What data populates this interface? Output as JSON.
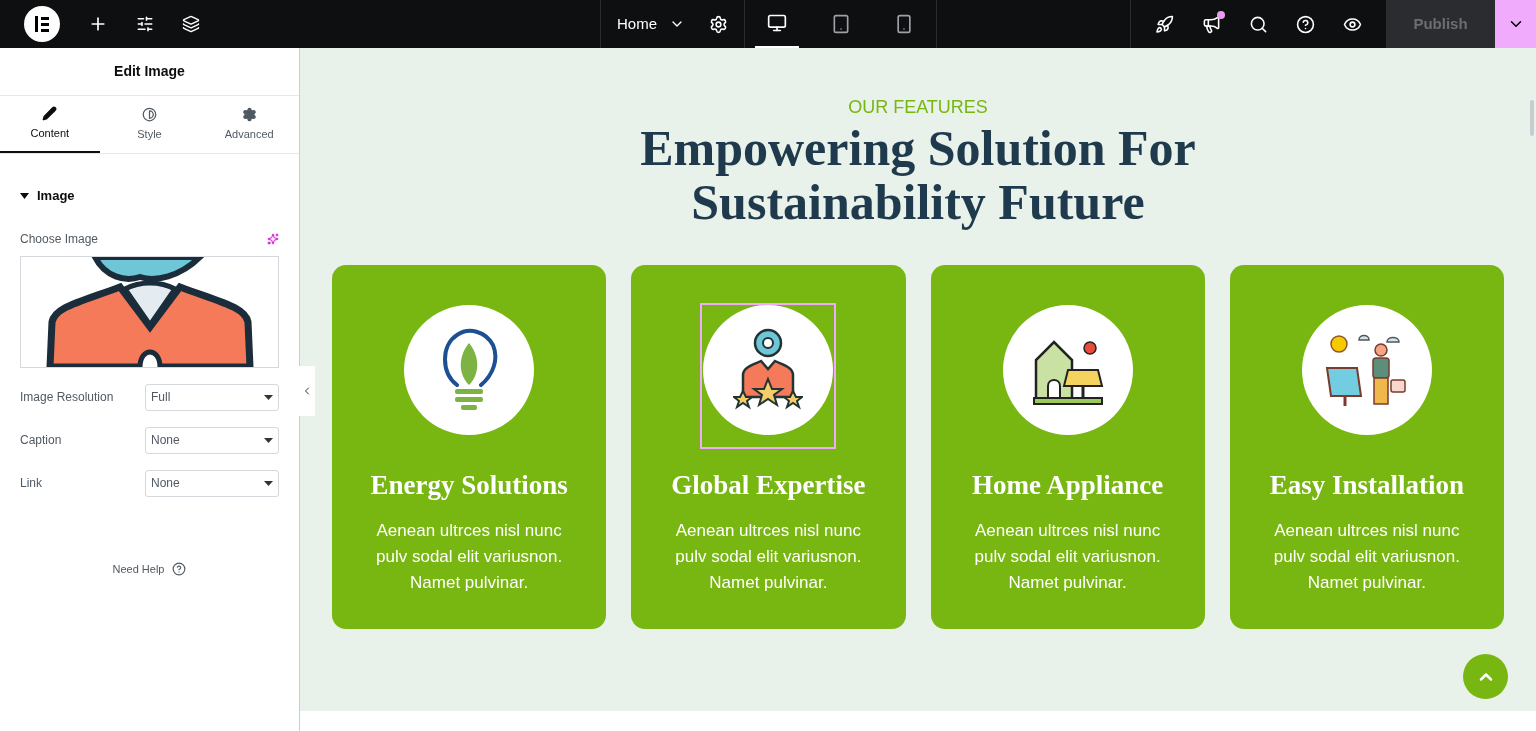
{
  "topbar": {
    "page": "Home",
    "devices": [
      {
        "kind": "desktop",
        "selected": true
      },
      {
        "kind": "tablet",
        "selected": false
      },
      {
        "kind": "mobile",
        "selected": false
      }
    ],
    "notification": true,
    "publish": {
      "label": "Publish",
      "disabled": true
    }
  },
  "panel": {
    "title": "Edit Image",
    "tabs": [
      {
        "kind": "content",
        "label": "Content",
        "selected": true
      },
      {
        "kind": "style",
        "label": "Style",
        "selected": false
      },
      {
        "kind": "advanced",
        "label": "Advanced",
        "selected": false
      }
    ],
    "section": {
      "title": "Image",
      "expanded": true
    },
    "choose_image": {
      "label": "Choose Image"
    },
    "fields": [
      {
        "label": "Image Resolution",
        "value": "Full"
      },
      {
        "label": "Caption",
        "value": "None"
      },
      {
        "label": "Link",
        "value": "None"
      }
    ],
    "need_help": "Need Help"
  },
  "canvas": {
    "eyebrow": "OUR FEATURES",
    "heading": "Empowering Solution For Sustainability Future",
    "cards": [
      {
        "kind": "bulb",
        "title": "Energy Solutions",
        "text": "Aenean ultrces nisl nunc pulv sodal elit variusnon. Namet pulvinar.",
        "selected": false
      },
      {
        "kind": "expert",
        "title": "Global Expertise",
        "text": "Aenean ultrces nisl nunc pulv sodal elit variusnon. Namet pulvinar.",
        "selected": true
      },
      {
        "kind": "house",
        "title": "Home Appliance",
        "text": "Aenean ultrces nisl nunc pulv sodal elit variusnon. Namet pulvinar.",
        "selected": false
      },
      {
        "kind": "installer",
        "title": "Easy Installation",
        "text": "Aenean ultrces nisl nunc pulv sodal elit variusnon. Namet pulvinar.",
        "selected": false
      }
    ]
  }
}
